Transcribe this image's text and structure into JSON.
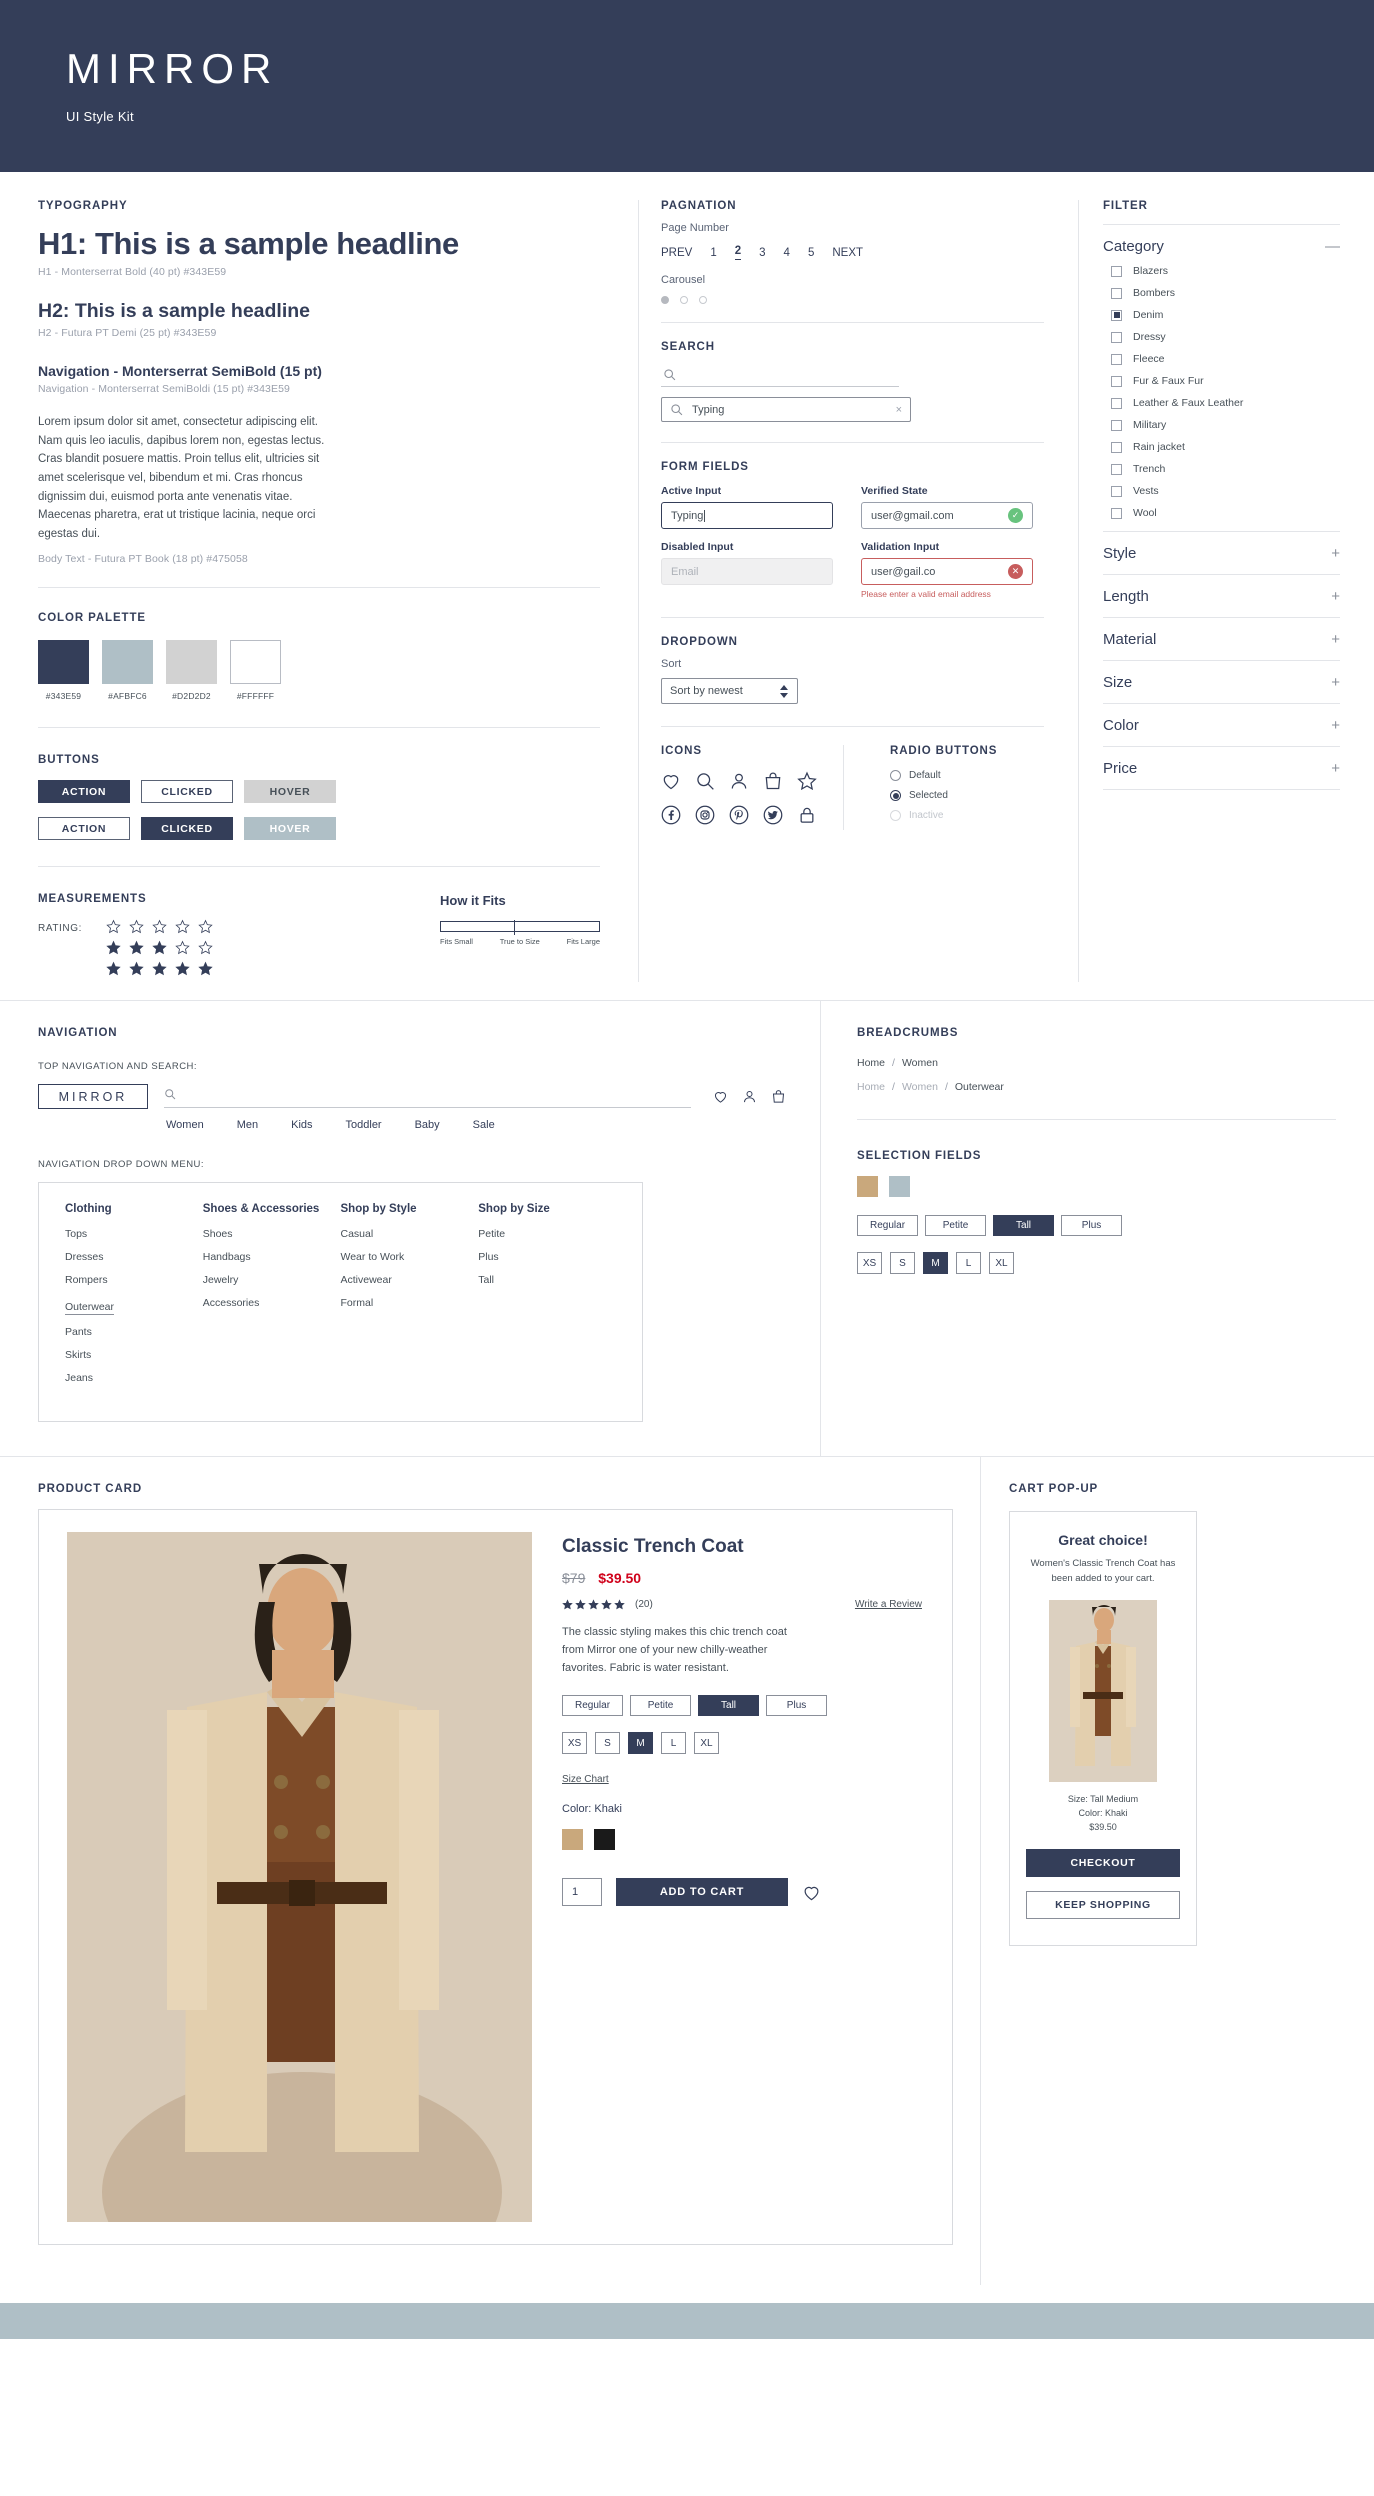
{
  "header": {
    "brand": "MIRROR",
    "subtitle": "UI Style Kit"
  },
  "typography": {
    "section_label": "TYPOGRAPHY",
    "h1_sample": "H1: This is a sample headline",
    "h1_spec": "H1 - Monterserrat Bold (40 pt) #343E59",
    "h2_sample": "H2: This is a sample headline",
    "h2_spec": "H2 - Futura PT Demi (25 pt) #343E59",
    "nav_sample": "Navigation - Monterserrat SemiBold (15 pt)",
    "nav_spec": "Navigation - Monterserrat SemiBoldi (15 pt) #343E59",
    "body_copy": "Lorem ipsum dolor sit amet, consectetur adipiscing elit. Nam quis leo iaculis, dapibus lorem non, egestas lectus. Cras blandit posuere mattis. Proin tellus elit, ultricies sit amet scelerisque vel, bibendum et mi. Cras rhoncus dignissim dui, euismod porta ante venenatis vitae. Maecenas pharetra, erat ut tristique lacinia, neque orci egestas dui.",
    "body_spec": "Body Text - Futura PT Book (18 pt) #475058"
  },
  "color_palette": {
    "section_label": "COLOR PALETTE",
    "swatches": [
      {
        "hex": "#343E59",
        "label": "#343E59"
      },
      {
        "hex": "#AFBFC6",
        "label": "#AFBFC6"
      },
      {
        "hex": "#D2D2D2",
        "label": "#D2D2D2"
      },
      {
        "hex": "#FFFFFF",
        "label": "#FFFFFF"
      }
    ]
  },
  "buttons": {
    "section_label": "BUTTONS",
    "row1": [
      "ACTION",
      "CLICKED",
      "HOVER"
    ],
    "row2": [
      "ACTION",
      "CLICKED",
      "HOVER"
    ]
  },
  "measurements": {
    "section_label": "MEASUREMENTS",
    "rating_label": "RATING:",
    "rating_rows": [
      0,
      3,
      5
    ],
    "fits_title": "How it Fits",
    "fits_legend": [
      "Fits Small",
      "True to Size",
      "Fits Large"
    ]
  },
  "pagination": {
    "section_label": "PAGNATION",
    "page_number_label": "Page Number",
    "prev": "PREV",
    "next": "NEXT",
    "pages": [
      "1",
      "2",
      "3",
      "4",
      "5"
    ],
    "active_page": "2",
    "carousel_label": "Carousel",
    "carousel_dots": 3,
    "carousel_active": 0
  },
  "search": {
    "section_label": "SEARCH",
    "empty_placeholder": "",
    "typing_value": "Typing",
    "clear_icon": "×"
  },
  "form_fields": {
    "section_label": "FORM FIELDS",
    "active_label": "Active Input",
    "active_value": "Typing",
    "verified_label": "Verified State",
    "verified_value": "user@gmail.com",
    "disabled_label": "Disabled Input",
    "disabled_placeholder": "Email",
    "validation_label": "Validation Input",
    "validation_value": "user@gail.co",
    "validation_error": "Please enter a valid email address"
  },
  "dropdown": {
    "section_label": "DROPDOWN",
    "sort_label": "Sort",
    "sort_value": "Sort by newest"
  },
  "icons": {
    "section_label": "ICONS",
    "row1": [
      "heart-icon",
      "search-icon",
      "user-icon",
      "bag-icon",
      "star-icon"
    ],
    "row2": [
      "facebook-icon",
      "instagram-icon",
      "pinterest-icon",
      "twitter-icon",
      "lock-icon"
    ]
  },
  "radio_buttons": {
    "section_label": "RADIO BUTTONS",
    "options": [
      {
        "label": "Default",
        "state": "default"
      },
      {
        "label": "Selected",
        "state": "selected"
      },
      {
        "label": "Inactive",
        "state": "inactive"
      }
    ]
  },
  "filter": {
    "section_label": "FILTER",
    "groups": [
      {
        "title": "Category",
        "sign": "—",
        "expanded": true,
        "items": [
          {
            "label": "Blazers",
            "checked": false
          },
          {
            "label": "Bombers",
            "checked": false
          },
          {
            "label": "Denim",
            "checked": true
          },
          {
            "label": "Dressy",
            "checked": false
          },
          {
            "label": "Fleece",
            "checked": false
          },
          {
            "label": "Fur & Faux Fur",
            "checked": false
          },
          {
            "label": "Leather & Faux Leather",
            "checked": false
          },
          {
            "label": "Military",
            "checked": false
          },
          {
            "label": "Rain jacket",
            "checked": false
          },
          {
            "label": "Trench",
            "checked": false
          },
          {
            "label": "Vests",
            "checked": false
          },
          {
            "label": "Wool",
            "checked": false
          }
        ]
      },
      {
        "title": "Style",
        "sign": "+",
        "expanded": false,
        "items": []
      },
      {
        "title": "Length",
        "sign": "+",
        "expanded": false,
        "items": []
      },
      {
        "title": "Material",
        "sign": "+",
        "expanded": false,
        "items": []
      },
      {
        "title": "Size",
        "sign": "+",
        "expanded": false,
        "items": []
      },
      {
        "title": "Color",
        "sign": "+",
        "expanded": false,
        "items": []
      },
      {
        "title": "Price",
        "sign": "+",
        "expanded": false,
        "items": []
      }
    ]
  },
  "navigation": {
    "section_label": "NAVIGATION",
    "top_caption": "TOP NAVIGATION AND SEARCH:",
    "logo": "MIRROR",
    "links": [
      "Women",
      "Men",
      "Kids",
      "Toddler",
      "Baby",
      "Sale"
    ],
    "dropdown_caption": "NAVIGATION DROP DOWN MENU:",
    "menu_columns": [
      {
        "title": "Clothing",
        "items": [
          "Tops",
          "Dresses",
          "Rompers",
          "Outerwear",
          "Pants",
          "Skirts",
          "Jeans"
        ],
        "active": "Outerwear"
      },
      {
        "title": "Shoes & Accessories",
        "items": [
          "Shoes",
          "Handbags",
          "Jewelry",
          "Accessories"
        ],
        "active": ""
      },
      {
        "title": "Shop by Style",
        "items": [
          "Casual",
          "Wear to Work",
          "Activewear",
          "Formal"
        ],
        "active": ""
      },
      {
        "title": "Shop by Size",
        "items": [
          "Petite",
          "Plus",
          "Tall"
        ],
        "active": ""
      }
    ]
  },
  "breadcrumbs": {
    "section_label": "BREADCRUMBS",
    "trail1": [
      "Home",
      "Women"
    ],
    "trail2": [
      "Home",
      "Women",
      "Outerwear"
    ]
  },
  "selection_fields": {
    "section_label": "SELECTION FIELDS",
    "colors": [
      "#C9A87C",
      "#AFBFC6"
    ],
    "fits": [
      "Regular",
      "Petite",
      "Tall",
      "Plus"
    ],
    "fit_selected": "Tall",
    "sizes": [
      "XS",
      "S",
      "M",
      "L",
      "XL"
    ],
    "size_selected": "M"
  },
  "product_card": {
    "section_label": "PRODUCT CARD",
    "title": "Classic Trench Coat",
    "old_price": "$79",
    "new_price": "$39.50",
    "stars": 5,
    "review_count": "(20)",
    "write_review": "Write a Review",
    "description": "The classic styling makes this chic trench coat from Mirror one of your new chilly-weather favorites. Fabric is water resistant.",
    "fits": [
      "Regular",
      "Petite",
      "Tall",
      "Plus"
    ],
    "fit_selected": "Tall",
    "sizes": [
      "XS",
      "S",
      "M",
      "L",
      "XL"
    ],
    "size_selected": "M",
    "size_chart": "Size Chart",
    "color_label": "Color:",
    "color_value": "Khaki",
    "swatches": [
      "#C9A87C",
      "#1A1A1A"
    ],
    "quantity": "1",
    "add_to_cart": "ADD TO CART"
  },
  "cart_popup": {
    "section_label": "CART POP-UP",
    "title": "Great choice!",
    "subtitle": "Women's Classic Trench Coat has been added to your cart.",
    "meta": [
      "Size: Tall Medium",
      "Color: Khaki",
      "$39.50"
    ],
    "checkout": "CHECKOUT",
    "keep_shopping": "KEEP SHOPPING"
  }
}
